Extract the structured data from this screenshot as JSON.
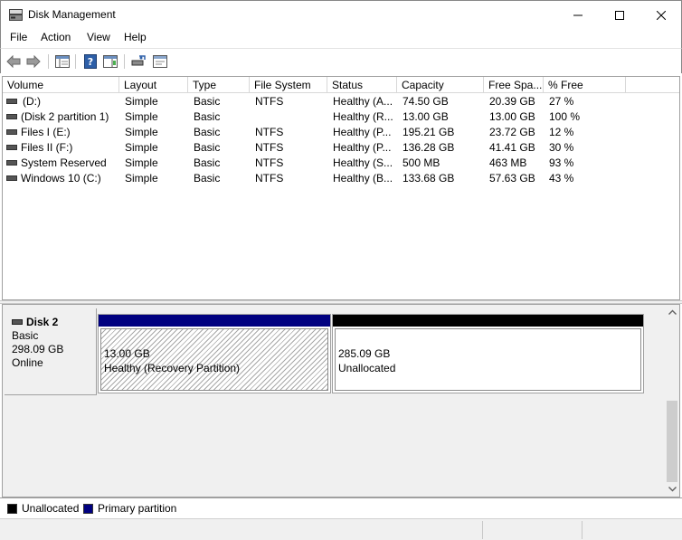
{
  "window": {
    "title": "Disk Management"
  },
  "menu": [
    "File",
    "Action",
    "View",
    "Help"
  ],
  "columns": [
    "Volume",
    "Layout",
    "Type",
    "File System",
    "Status",
    "Capacity",
    "Free Spa...",
    "% Free"
  ],
  "volumes": [
    {
      "volume": "(D:)",
      "layout": "Simple",
      "type": "Basic",
      "fs": "NTFS",
      "status": "Healthy (A...",
      "capacity": "74.50 GB",
      "free": "20.39 GB",
      "pct": "27 %"
    },
    {
      "volume": "(Disk 2 partition 1)",
      "layout": "Simple",
      "type": "Basic",
      "fs": "",
      "status": "Healthy (R...",
      "capacity": "13.00 GB",
      "free": "13.00 GB",
      "pct": "100 %"
    },
    {
      "volume": "Files I (E:)",
      "layout": "Simple",
      "type": "Basic",
      "fs": "NTFS",
      "status": "Healthy (P...",
      "capacity": "195.21 GB",
      "free": "23.72 GB",
      "pct": "12 %"
    },
    {
      "volume": "Files II (F:)",
      "layout": "Simple",
      "type": "Basic",
      "fs": "NTFS",
      "status": "Healthy (P...",
      "capacity": "136.28 GB",
      "free": "41.41 GB",
      "pct": "30 %"
    },
    {
      "volume": "System Reserved",
      "layout": "Simple",
      "type": "Basic",
      "fs": "NTFS",
      "status": "Healthy (S...",
      "capacity": "500 MB",
      "free": "463 MB",
      "pct": "93 %"
    },
    {
      "volume": "Windows 10 (C:)",
      "layout": "Simple",
      "type": "Basic",
      "fs": "NTFS",
      "status": "Healthy (B...",
      "capacity": "133.68 GB",
      "free": "57.63 GB",
      "pct": "43 %"
    }
  ],
  "disk": {
    "name": "Disk 2",
    "kind": "Basic",
    "size": "298.09 GB",
    "state": "Online",
    "partitions": [
      {
        "size": "13.00 GB",
        "status": "Healthy (Recovery Partition)",
        "color": "#000080"
      },
      {
        "size": "285.09 GB",
        "status": "Unallocated",
        "color": "#000000"
      }
    ]
  },
  "legend": [
    {
      "label": "Unallocated",
      "color": "#000000"
    },
    {
      "label": "Primary partition",
      "color": "#000080"
    }
  ]
}
